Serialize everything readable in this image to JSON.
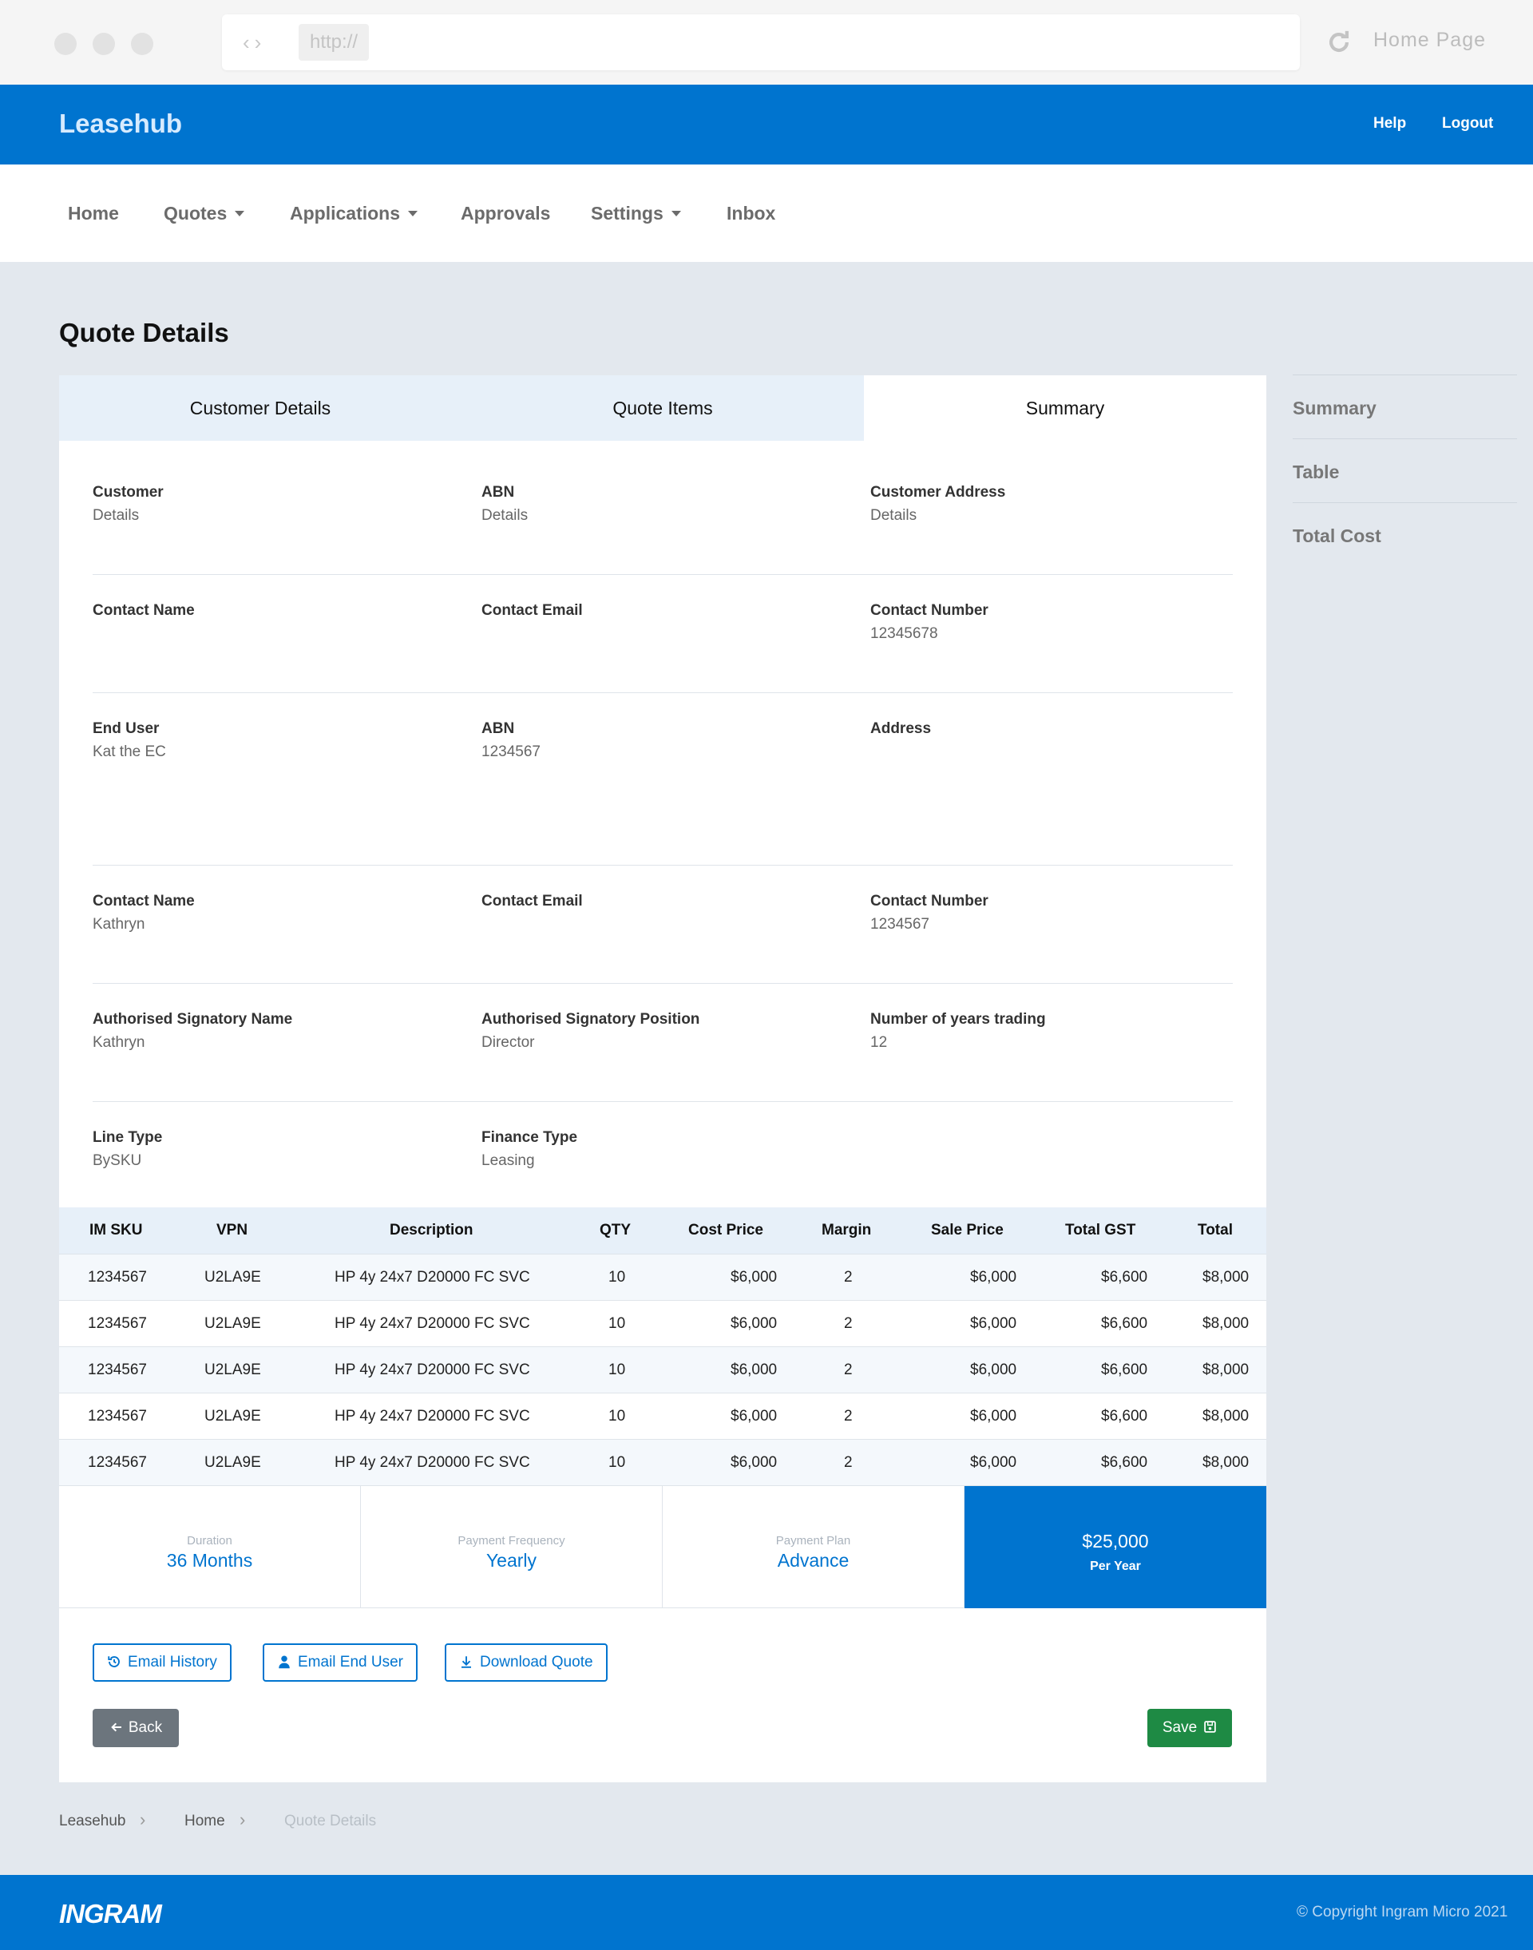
{
  "browser": {
    "url": "http://",
    "home_page": "Home Page"
  },
  "header": {
    "brand": "Leasehub",
    "help": "Help",
    "logout": "Logout"
  },
  "nav": {
    "items": [
      "Home",
      "Quotes",
      "Applications",
      "Approvals",
      "Settings",
      "Inbox"
    ]
  },
  "page_title": "Quote Details",
  "tabs": [
    "Customer Details",
    "Quote Items",
    "Summary"
  ],
  "active_tab": "Summary",
  "fields": [
    [
      {
        "label": "Customer",
        "value": "Details"
      },
      {
        "label": "ABN",
        "value": "Details"
      },
      {
        "label": "Customer Address",
        "value": "Details"
      }
    ],
    [
      {
        "label": "Contact Name",
        "value": ""
      },
      {
        "label": "Contact Email",
        "value": ""
      },
      {
        "label": "Contact Number",
        "value": "12345678"
      }
    ],
    [
      {
        "label": "End User",
        "value": "Kat the EC"
      },
      {
        "label": "ABN",
        "value": "1234567"
      },
      {
        "label": "Address",
        "value": ""
      }
    ],
    [
      {
        "label": "Contact Name",
        "value": "Kathryn"
      },
      {
        "label": "Contact Email",
        "value": ""
      },
      {
        "label": "Contact Number",
        "value": "1234567"
      }
    ],
    [
      {
        "label": "Authorised Signatory Name",
        "value": "Kathryn"
      },
      {
        "label": "Authorised Signatory Position",
        "value": "Director"
      },
      {
        "label": "Number of years trading",
        "value": "12"
      }
    ],
    [
      {
        "label": "Line Type",
        "value": "BySKU"
      },
      {
        "label": "Finance Type",
        "value": "Leasing"
      }
    ]
  ],
  "table": {
    "headers": [
      "IM SKU",
      "VPN",
      "Description",
      "QTY",
      "Cost Price",
      "Margin",
      "Sale Price",
      "Total GST",
      "Total"
    ],
    "rows": [
      [
        "1234567",
        "U2LA9E",
        "HP 4y 24x7 D20000 FC SVC",
        "10",
        "$6,000",
        "2",
        "$6,000",
        "$6,600",
        "$8,000"
      ],
      [
        "1234567",
        "U2LA9E",
        "HP 4y 24x7 D20000 FC SVC",
        "10",
        "$6,000",
        "2",
        "$6,000",
        "$6,600",
        "$8,000"
      ],
      [
        "1234567",
        "U2LA9E",
        "HP 4y 24x7 D20000 FC SVC",
        "10",
        "$6,000",
        "2",
        "$6,000",
        "$6,600",
        "$8,000"
      ],
      [
        "1234567",
        "U2LA9E",
        "HP 4y 24x7 D20000 FC SVC",
        "10",
        "$6,000",
        "2",
        "$6,000",
        "$6,600",
        "$8,000"
      ],
      [
        "1234567",
        "U2LA9E",
        "HP 4y 24x7 D20000 FC SVC",
        "10",
        "$6,000",
        "2",
        "$6,000",
        "$6,600",
        "$8,000"
      ]
    ]
  },
  "summary": {
    "duration_label": "Duration",
    "duration_value": "36 Months",
    "frequency_label": "Payment Frequency",
    "frequency_value": "Yearly",
    "plan_label": "Payment Plan",
    "plan_value": "Advance",
    "total_value": "$25,000",
    "total_sub": "Per Year"
  },
  "actions": {
    "email_history": "Email History",
    "email_end_user": "Email End User",
    "download_quote": "Download Quote",
    "back": "Back",
    "save": "Save"
  },
  "side_nav": [
    "Summary",
    "Table",
    "Total Cost"
  ],
  "breadcrumb": [
    "Leasehub",
    "Home",
    "Quote Details"
  ],
  "footer": {
    "logo": "INGRAM",
    "copyright": "© Copyright Ingram Micro 2021"
  },
  "colors": {
    "primary": "#0074cf",
    "success": "#1e8a44",
    "secondary": "#6c757d",
    "tab_bg": "#e7f0f9"
  }
}
